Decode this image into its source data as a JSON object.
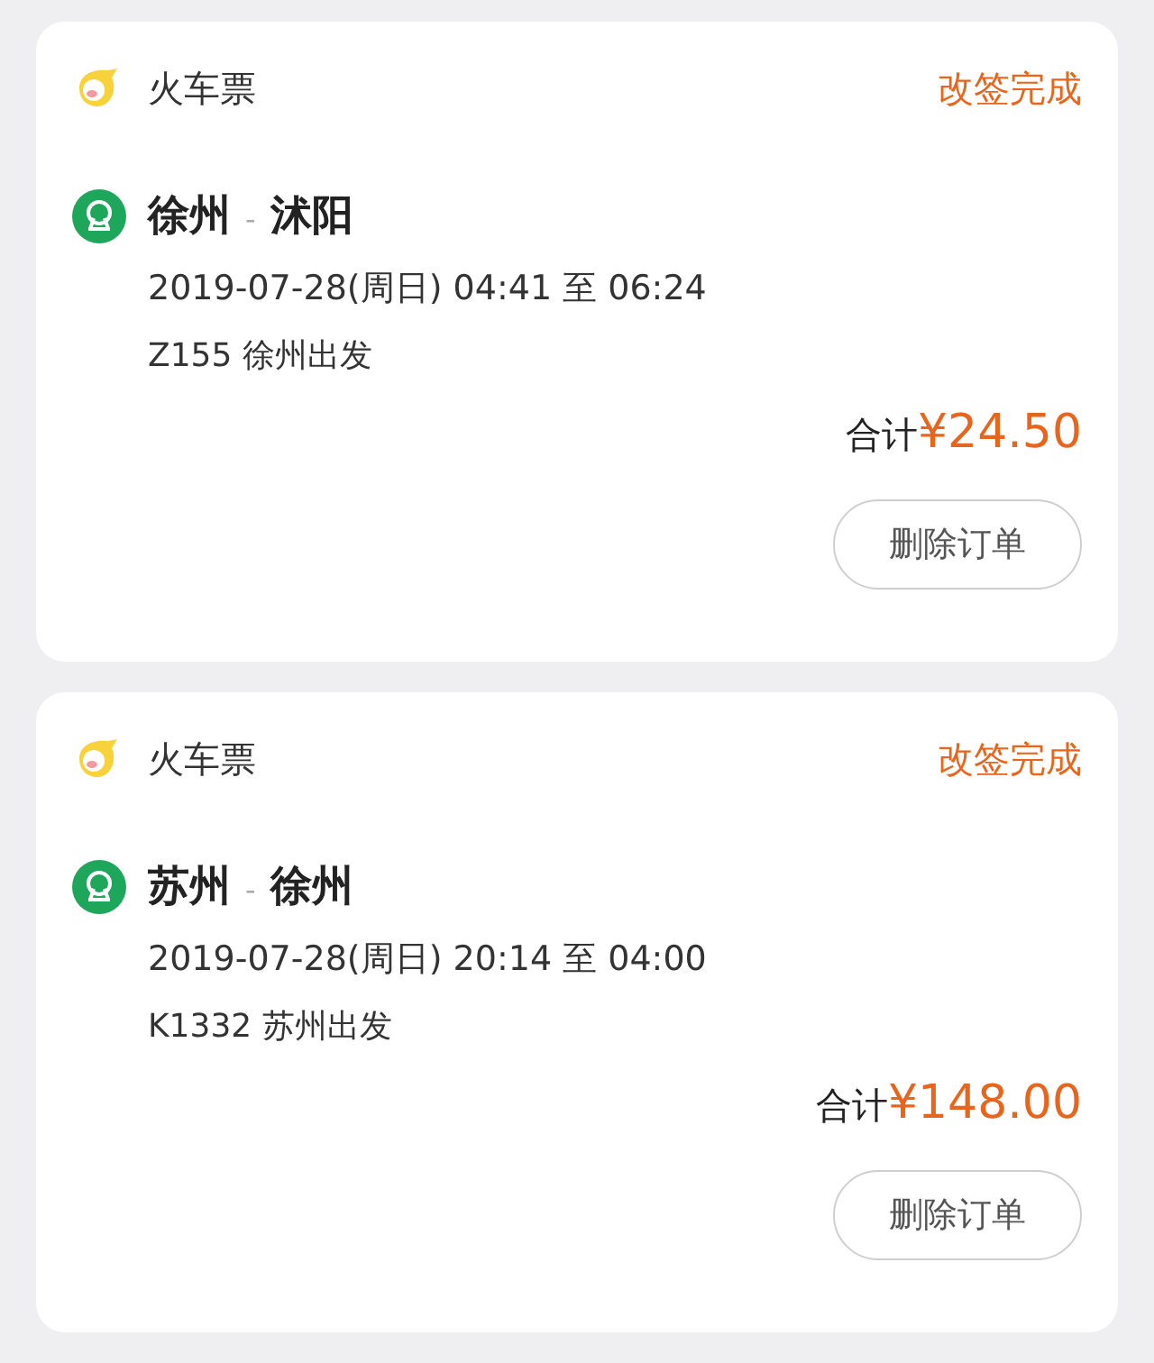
{
  "orders": [
    {
      "category": "火车票",
      "status": "改签完成",
      "from": "徐州",
      "separator": "-",
      "to": "沭阳",
      "datetime": "2019-07-28(周日) 04:41 至 06:24",
      "train": "Z155 徐州出发",
      "total_label": "合计",
      "total": "¥24.50",
      "button": "删除订单"
    },
    {
      "category": "火车票",
      "status": "改签完成",
      "from": "苏州",
      "separator": "-",
      "to": "徐州",
      "datetime": "2019-07-28(周日) 20:14 至 04:00",
      "train": "K1332 苏州出发",
      "total_label": "合计",
      "total": "¥148.00",
      "button": "删除订单"
    }
  ]
}
